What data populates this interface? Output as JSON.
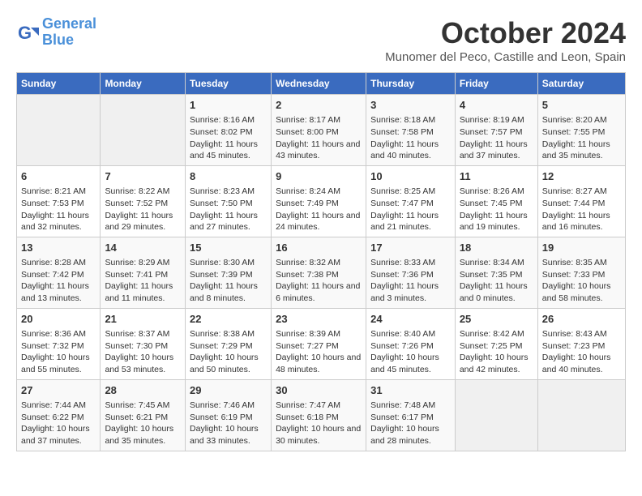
{
  "logo": {
    "line1": "General",
    "line2": "Blue"
  },
  "title": "October 2024",
  "location": "Munomer del Peco, Castille and Leon, Spain",
  "weekdays": [
    "Sunday",
    "Monday",
    "Tuesday",
    "Wednesday",
    "Thursday",
    "Friday",
    "Saturday"
  ],
  "weeks": [
    [
      {
        "day": "",
        "info": ""
      },
      {
        "day": "",
        "info": ""
      },
      {
        "day": "1",
        "info": "Sunrise: 8:16 AM\nSunset: 8:02 PM\nDaylight: 11 hours and 45 minutes."
      },
      {
        "day": "2",
        "info": "Sunrise: 8:17 AM\nSunset: 8:00 PM\nDaylight: 11 hours and 43 minutes."
      },
      {
        "day": "3",
        "info": "Sunrise: 8:18 AM\nSunset: 7:58 PM\nDaylight: 11 hours and 40 minutes."
      },
      {
        "day": "4",
        "info": "Sunrise: 8:19 AM\nSunset: 7:57 PM\nDaylight: 11 hours and 37 minutes."
      },
      {
        "day": "5",
        "info": "Sunrise: 8:20 AM\nSunset: 7:55 PM\nDaylight: 11 hours and 35 minutes."
      }
    ],
    [
      {
        "day": "6",
        "info": "Sunrise: 8:21 AM\nSunset: 7:53 PM\nDaylight: 11 hours and 32 minutes."
      },
      {
        "day": "7",
        "info": "Sunrise: 8:22 AM\nSunset: 7:52 PM\nDaylight: 11 hours and 29 minutes."
      },
      {
        "day": "8",
        "info": "Sunrise: 8:23 AM\nSunset: 7:50 PM\nDaylight: 11 hours and 27 minutes."
      },
      {
        "day": "9",
        "info": "Sunrise: 8:24 AM\nSunset: 7:49 PM\nDaylight: 11 hours and 24 minutes."
      },
      {
        "day": "10",
        "info": "Sunrise: 8:25 AM\nSunset: 7:47 PM\nDaylight: 11 hours and 21 minutes."
      },
      {
        "day": "11",
        "info": "Sunrise: 8:26 AM\nSunset: 7:45 PM\nDaylight: 11 hours and 19 minutes."
      },
      {
        "day": "12",
        "info": "Sunrise: 8:27 AM\nSunset: 7:44 PM\nDaylight: 11 hours and 16 minutes."
      }
    ],
    [
      {
        "day": "13",
        "info": "Sunrise: 8:28 AM\nSunset: 7:42 PM\nDaylight: 11 hours and 13 minutes."
      },
      {
        "day": "14",
        "info": "Sunrise: 8:29 AM\nSunset: 7:41 PM\nDaylight: 11 hours and 11 minutes."
      },
      {
        "day": "15",
        "info": "Sunrise: 8:30 AM\nSunset: 7:39 PM\nDaylight: 11 hours and 8 minutes."
      },
      {
        "day": "16",
        "info": "Sunrise: 8:32 AM\nSunset: 7:38 PM\nDaylight: 11 hours and 6 minutes."
      },
      {
        "day": "17",
        "info": "Sunrise: 8:33 AM\nSunset: 7:36 PM\nDaylight: 11 hours and 3 minutes."
      },
      {
        "day": "18",
        "info": "Sunrise: 8:34 AM\nSunset: 7:35 PM\nDaylight: 11 hours and 0 minutes."
      },
      {
        "day": "19",
        "info": "Sunrise: 8:35 AM\nSunset: 7:33 PM\nDaylight: 10 hours and 58 minutes."
      }
    ],
    [
      {
        "day": "20",
        "info": "Sunrise: 8:36 AM\nSunset: 7:32 PM\nDaylight: 10 hours and 55 minutes."
      },
      {
        "day": "21",
        "info": "Sunrise: 8:37 AM\nSunset: 7:30 PM\nDaylight: 10 hours and 53 minutes."
      },
      {
        "day": "22",
        "info": "Sunrise: 8:38 AM\nSunset: 7:29 PM\nDaylight: 10 hours and 50 minutes."
      },
      {
        "day": "23",
        "info": "Sunrise: 8:39 AM\nSunset: 7:27 PM\nDaylight: 10 hours and 48 minutes."
      },
      {
        "day": "24",
        "info": "Sunrise: 8:40 AM\nSunset: 7:26 PM\nDaylight: 10 hours and 45 minutes."
      },
      {
        "day": "25",
        "info": "Sunrise: 8:42 AM\nSunset: 7:25 PM\nDaylight: 10 hours and 42 minutes."
      },
      {
        "day": "26",
        "info": "Sunrise: 8:43 AM\nSunset: 7:23 PM\nDaylight: 10 hours and 40 minutes."
      }
    ],
    [
      {
        "day": "27",
        "info": "Sunrise: 7:44 AM\nSunset: 6:22 PM\nDaylight: 10 hours and 37 minutes."
      },
      {
        "day": "28",
        "info": "Sunrise: 7:45 AM\nSunset: 6:21 PM\nDaylight: 10 hours and 35 minutes."
      },
      {
        "day": "29",
        "info": "Sunrise: 7:46 AM\nSunset: 6:19 PM\nDaylight: 10 hours and 33 minutes."
      },
      {
        "day": "30",
        "info": "Sunrise: 7:47 AM\nSunset: 6:18 PM\nDaylight: 10 hours and 30 minutes."
      },
      {
        "day": "31",
        "info": "Sunrise: 7:48 AM\nSunset: 6:17 PM\nDaylight: 10 hours and 28 minutes."
      },
      {
        "day": "",
        "info": ""
      },
      {
        "day": "",
        "info": ""
      }
    ]
  ]
}
